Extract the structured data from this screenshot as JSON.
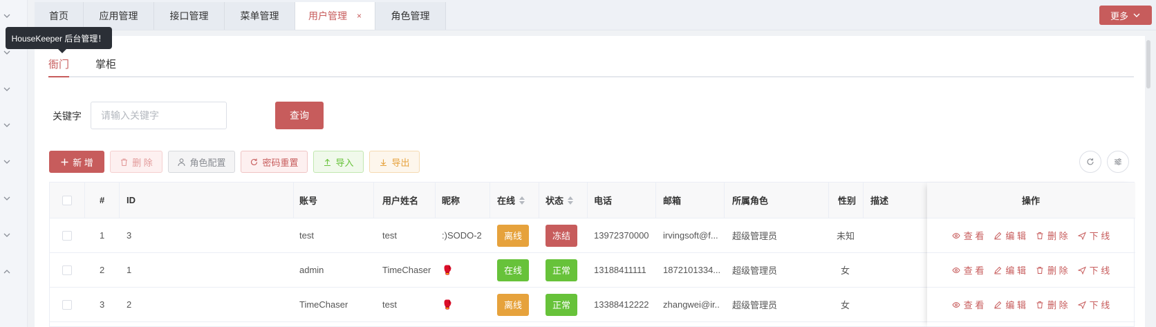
{
  "colors": {
    "accent": "#c75c5c",
    "success": "#67c23a",
    "warning": "#e6a23c",
    "danger": "#c75c5c"
  },
  "tabs": [
    {
      "label": "首页"
    },
    {
      "label": "应用管理"
    },
    {
      "label": "接口管理"
    },
    {
      "label": "菜单管理"
    },
    {
      "label": "用户管理",
      "close": "×"
    },
    {
      "label": "角色管理"
    }
  ],
  "more_label": "更多",
  "tooltip": "HouseKeeper 后台管理！",
  "subtabs": [
    {
      "label": "衙门"
    },
    {
      "label": "掌柜"
    }
  ],
  "search": {
    "label": "关键字",
    "placeholder": "请输入关键字",
    "value": "",
    "button": "查询"
  },
  "toolbar": {
    "add": "新 增",
    "delete": "删 除",
    "role_config": "角色配置",
    "reset_pwd": "密码重置",
    "import": "导入",
    "export": "导出"
  },
  "table": {
    "headers": {
      "index": "#",
      "id": "ID",
      "account": "账号",
      "username": "用户姓名",
      "nickname": "昵称",
      "online": "在线",
      "status": "状态",
      "phone": "电话",
      "email": "邮箱",
      "role": "所属角色",
      "gender": "性别",
      "desc": "描述",
      "ops": "操作"
    },
    "rows": [
      {
        "index": "1",
        "id": "3",
        "account": "test",
        "username": "test",
        "nickname": ":)SODO-2",
        "online": "离线",
        "status": "冻结",
        "phone": "13972370000",
        "email": "irvingsoft@f...",
        "role": "超级管理员",
        "gender": "未知",
        "desc": ""
      },
      {
        "index": "2",
        "id": "1",
        "account": "admin",
        "username": "TimeChaser",
        "nickname": "🥊",
        "online": "在线",
        "status": "正常",
        "phone": "13188411111",
        "email": "1872101334...",
        "role": "超级管理员",
        "gender": "女",
        "desc": ""
      },
      {
        "index": "3",
        "id": "2",
        "account": "TimeChaser",
        "username": "test",
        "nickname": "🥊",
        "online": "离线",
        "status": "正常",
        "phone": "13388412222",
        "email": "zhangwei@ir...",
        "role": "超级管理员",
        "gender": "女",
        "desc": ""
      }
    ],
    "ops": {
      "view": "查 看",
      "edit": "编 辑",
      "delete": "删 除",
      "offline": "下 线"
    }
  }
}
